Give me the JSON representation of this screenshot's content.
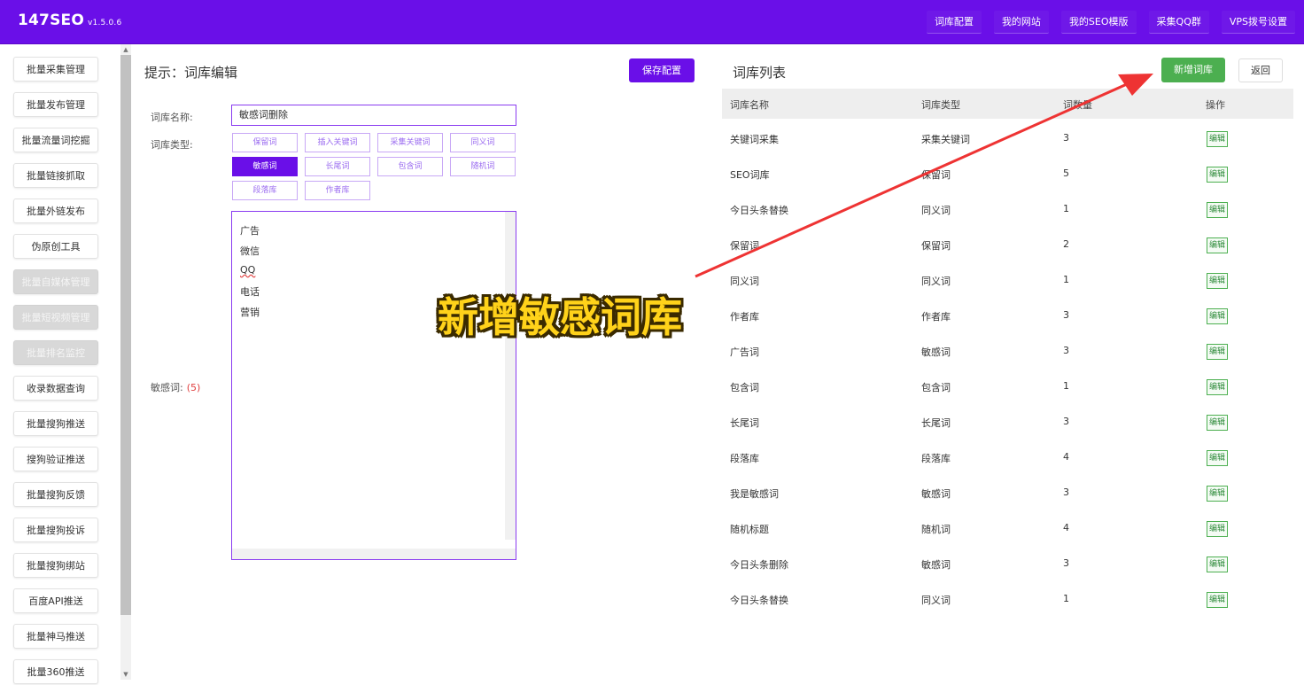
{
  "app": {
    "brand": "147SEO",
    "version": "v1.5.0.6"
  },
  "topnav": [
    "词库配置",
    "我的网站",
    "我的SEO模版",
    "采集QQ群",
    "VPS拨号设置"
  ],
  "sidebar": {
    "items": [
      {
        "label": "批量采集管理",
        "disabled": false
      },
      {
        "label": "批量发布管理",
        "disabled": false
      },
      {
        "label": "批量流量词挖掘",
        "disabled": false
      },
      {
        "label": "批量链接抓取",
        "disabled": false
      },
      {
        "label": "批量外链发布",
        "disabled": false
      },
      {
        "label": "伪原创工具",
        "disabled": false
      },
      {
        "label": "批量自媒体管理",
        "disabled": true
      },
      {
        "label": "批量短视频管理",
        "disabled": true
      },
      {
        "label": "批量排名监控",
        "disabled": true
      },
      {
        "label": "收录数据查询",
        "disabled": false
      },
      {
        "label": "批量搜狗推送",
        "disabled": false
      },
      {
        "label": "搜狗验证推送",
        "disabled": false
      },
      {
        "label": "批量搜狗反馈",
        "disabled": false
      },
      {
        "label": "批量搜狗投诉",
        "disabled": false
      },
      {
        "label": "批量搜狗绑站",
        "disabled": false
      },
      {
        "label": "百度API推送",
        "disabled": false
      },
      {
        "label": "批量神马推送",
        "disabled": false
      },
      {
        "label": "批量360推送",
        "disabled": false
      }
    ]
  },
  "editor": {
    "title": "提示：词库编辑",
    "save_label": "保存配置",
    "name_label": "词库名称:",
    "name_value": "敏感词删除",
    "type_label": "词库类型:",
    "types": [
      "保留词",
      "插入关键词",
      "采集关键词",
      "同义词",
      "敏感词",
      "长尾词",
      "包含词",
      "随机词",
      "段落库",
      "作者库"
    ],
    "active_type": "敏感词",
    "words": [
      "广告",
      "微信",
      "QQ",
      "电话",
      "营销"
    ],
    "words_label": "敏感词:",
    "words_count": "(5)"
  },
  "list": {
    "title": "词库列表",
    "add_label": "新增词库",
    "back_label": "返回",
    "headers": [
      "词库名称",
      "词库类型",
      "词数量",
      "操作"
    ],
    "edit_label": "编辑",
    "rows": [
      {
        "name": "关键词采集",
        "type": "采集关键词",
        "count": "3"
      },
      {
        "name": "SEO词库",
        "type": "保留词",
        "count": "5"
      },
      {
        "name": "今日头条替换",
        "type": "同义词",
        "count": "1"
      },
      {
        "name": "保留词",
        "type": "保留词",
        "count": "2"
      },
      {
        "name": "同义词",
        "type": "同义词",
        "count": "1"
      },
      {
        "name": "作者库",
        "type": "作者库",
        "count": "3"
      },
      {
        "name": "广告词",
        "type": "敏感词",
        "count": "3"
      },
      {
        "name": "包含词",
        "type": "包含词",
        "count": "1"
      },
      {
        "name": "长尾词",
        "type": "长尾词",
        "count": "3"
      },
      {
        "name": "段落库",
        "type": "段落库",
        "count": "4"
      },
      {
        "name": "我是敏感词",
        "type": "敏感词",
        "count": "3"
      },
      {
        "name": "随机标题",
        "type": "随机词",
        "count": "4"
      },
      {
        "name": "今日头条删除",
        "type": "敏感词",
        "count": "3"
      },
      {
        "name": "今日头条替换",
        "type": "同义词",
        "count": "1"
      }
    ]
  },
  "annotation": {
    "callout": "新增敏感词库",
    "arrow_color": "#ee3333"
  },
  "colors": {
    "primary": "#6a0fe8",
    "success": "#4caf50",
    "danger": "#e04040"
  }
}
